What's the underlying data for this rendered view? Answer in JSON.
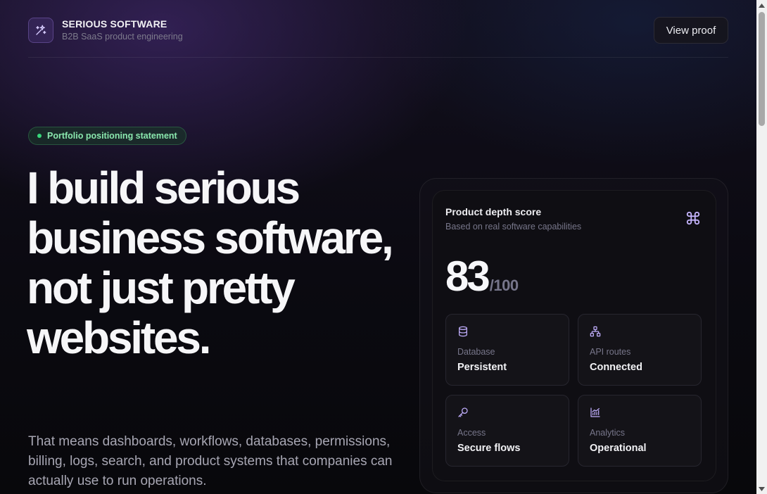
{
  "brand": {
    "name": "SERIOUS SOFTWARE",
    "tagline": "B2B SaaS product engineering",
    "icon": "sparkle-wand-icon"
  },
  "header": {
    "cta_label": "View proof"
  },
  "hero": {
    "badge": "Portfolio positioning statement",
    "headline": "I build serious business software, not just pretty websites.",
    "subtext": "That means dashboards, workflows, databases, permissions, billing, logs, search, and product systems that companies can actually use to run operations."
  },
  "score_card": {
    "title": "Product depth score",
    "subtitle": "Based on real software capabilities",
    "icon": "command-icon",
    "score": "83",
    "score_max": "/100",
    "tiles": [
      {
        "icon": "database-icon",
        "label": "Database",
        "value": "Persistent"
      },
      {
        "icon": "sitemap-icon",
        "label": "API routes",
        "value": "Connected"
      },
      {
        "icon": "key-icon",
        "label": "Access",
        "value": "Secure flows"
      },
      {
        "icon": "chart-icon",
        "label": "Analytics",
        "value": "Operational"
      }
    ]
  },
  "colors": {
    "accent_purple": "#b39cf5",
    "badge_green": "#37d67a",
    "background": "#09080d"
  }
}
